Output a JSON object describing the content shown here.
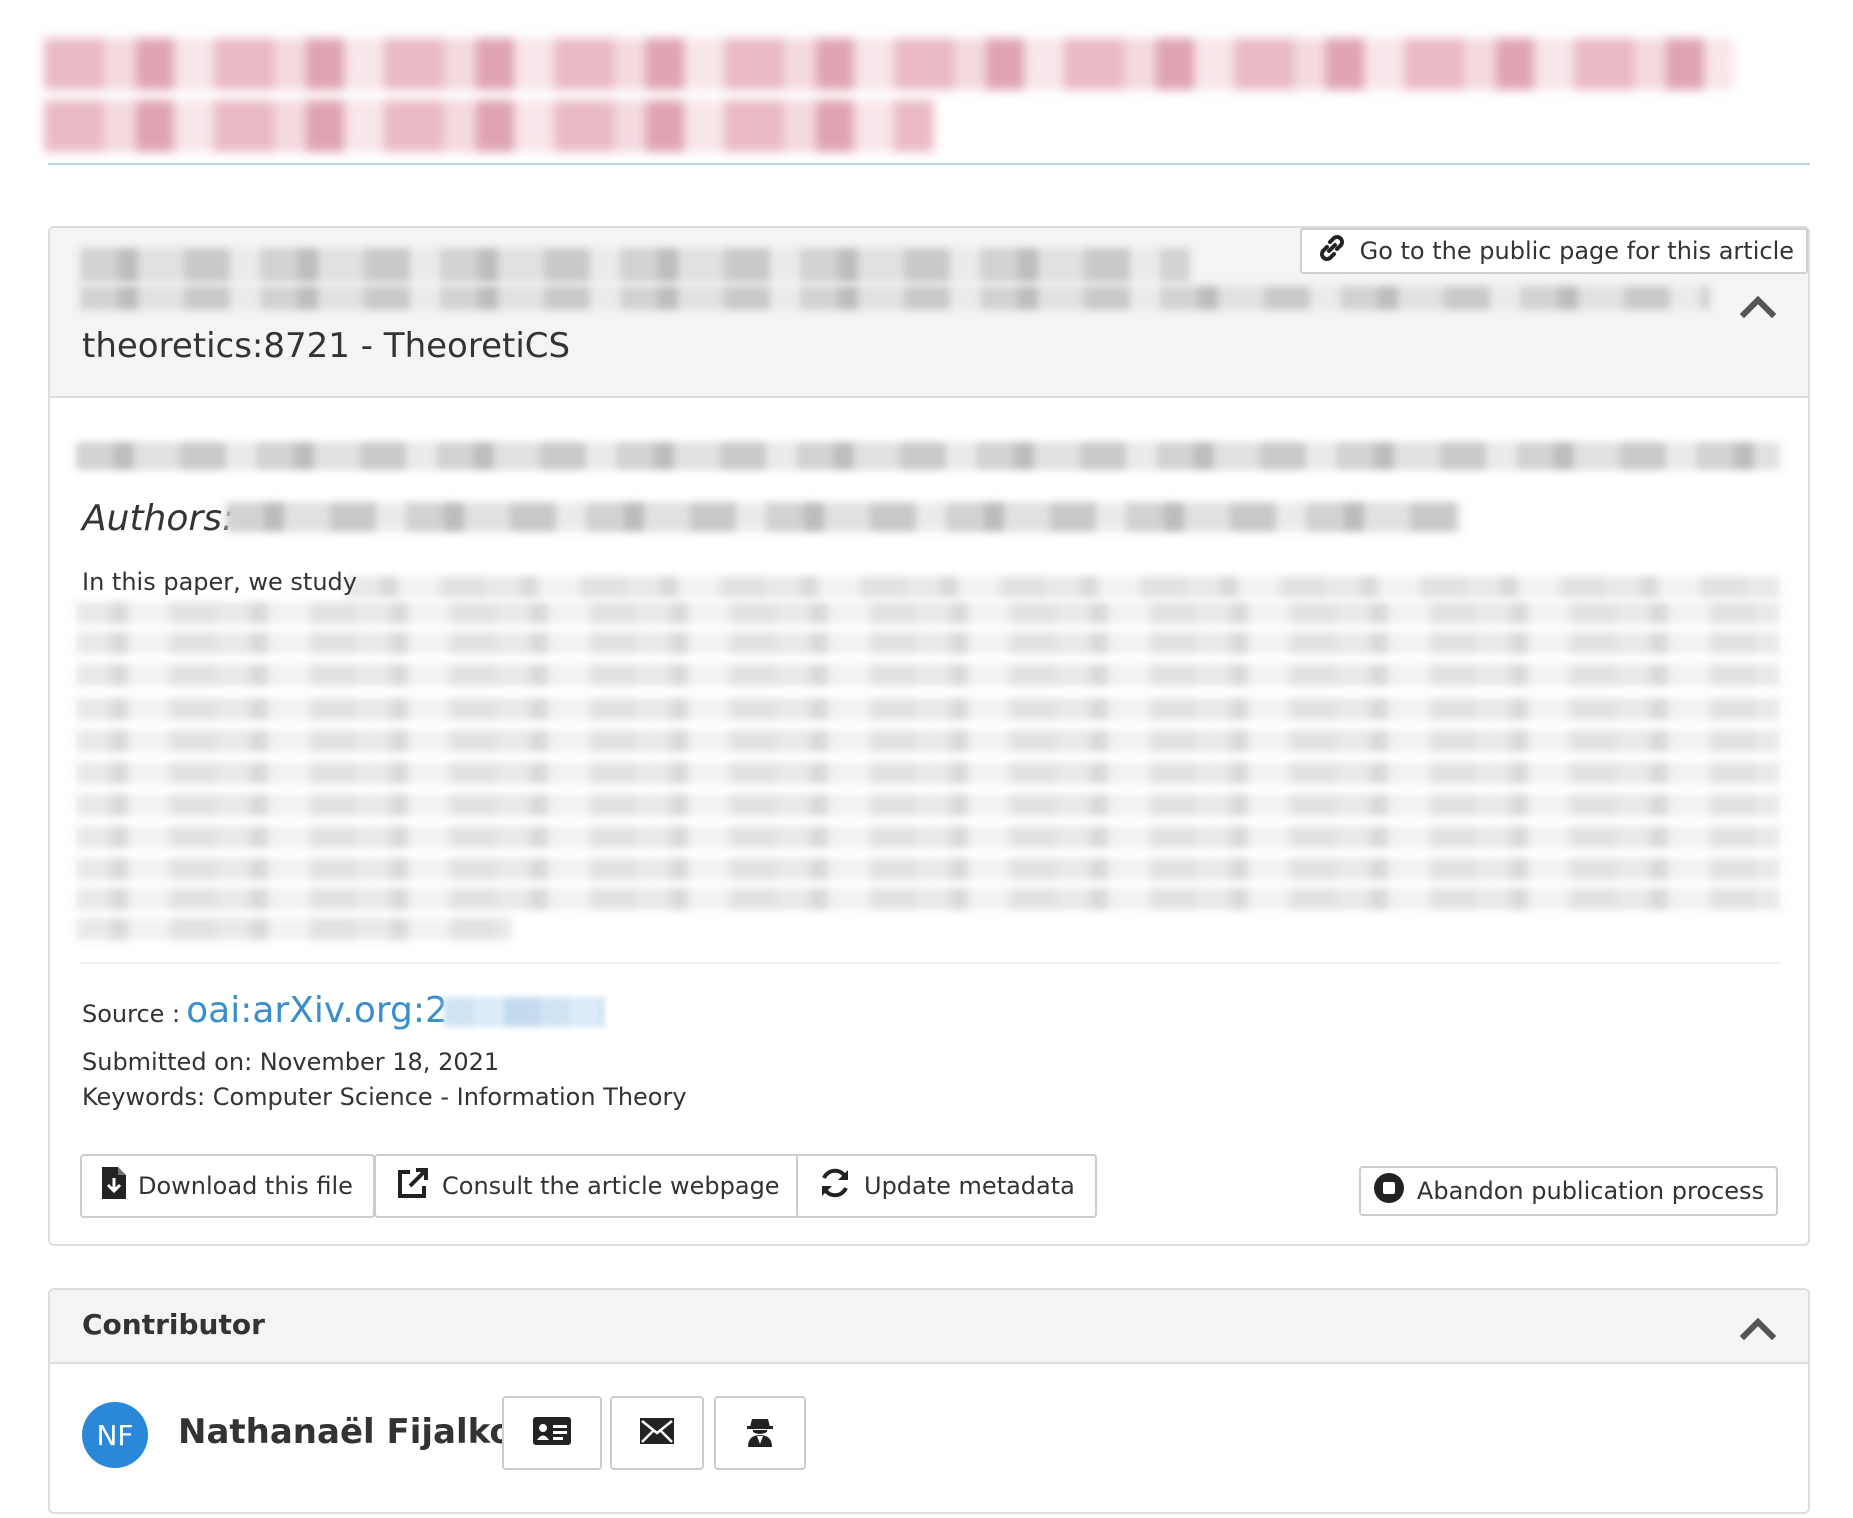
{
  "article_panel": {
    "public_page_label": "Go to the public page for this article",
    "journal_line": "theoretics:8721 - TheoretiCS",
    "authors_label": "Authors:",
    "abstract_start": "In this paper, we study",
    "source_label": "Source :",
    "source_link": "oai:arXiv.org:2",
    "submitted_on": "Submitted on: November 18, 2021",
    "keywords": "Keywords: Computer Science - Information Theory",
    "actions": {
      "download_label": "Download this file",
      "consult_label": "Consult the article webpage",
      "update_label": "Update metadata",
      "abandon_label": "Abandon publication process"
    }
  },
  "contributor_panel": {
    "title": "Contributor",
    "avatar_initials": "NF",
    "name": "Nathanaël Fijalkow"
  },
  "icons": {
    "link": "link-icon",
    "collapse": "chevron-up-icon",
    "download": "file-download-icon",
    "external": "external-link-icon",
    "refresh": "refresh-icon",
    "stop": "stop-circle-icon",
    "profile_card": "id-card-icon",
    "email": "envelope-icon",
    "impersonate": "user-secret-icon"
  },
  "colors": {
    "link": "#3a8ecb",
    "avatar": "#2b88d8",
    "panel_heading": "#f4f4f4",
    "title_divider": "#b9d9ea"
  }
}
